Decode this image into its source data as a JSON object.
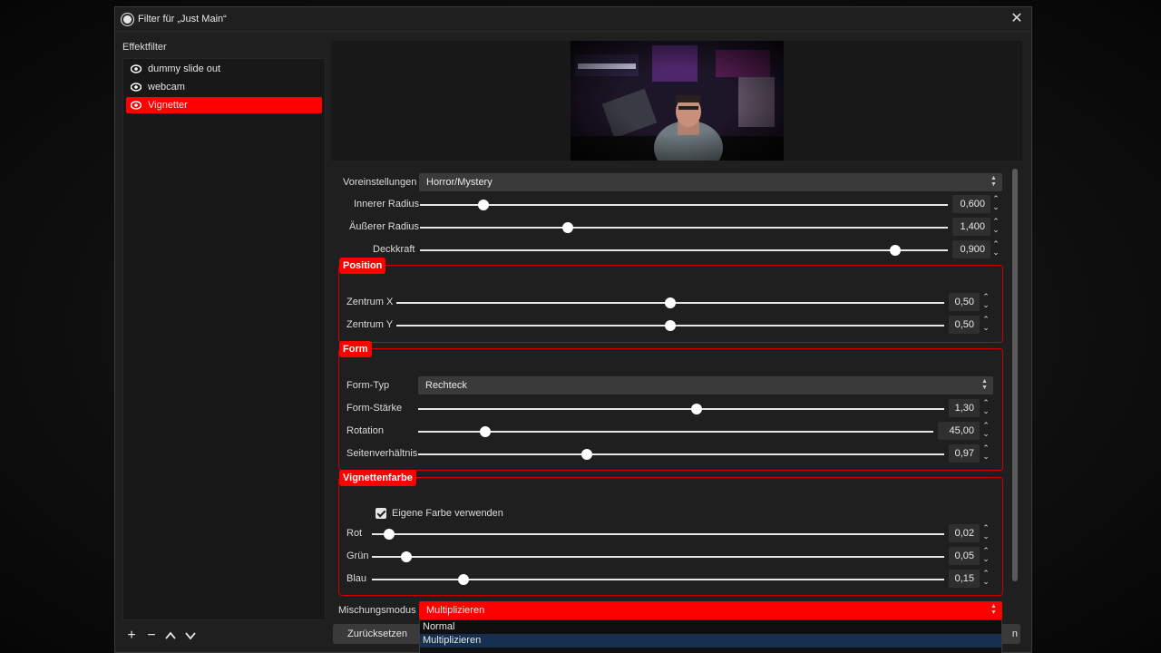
{
  "window": {
    "title": "Filter für „Just Main“"
  },
  "filters": {
    "heading": "Effektfilter",
    "items": [
      {
        "label": "dummy slide out",
        "selected": false
      },
      {
        "label": "webcam",
        "selected": false
      },
      {
        "label": "Vignetter",
        "selected": true
      }
    ]
  },
  "settings": {
    "preset": {
      "label": "Voreinstellungen",
      "value": "Horror/Mystery"
    },
    "inner_radius": {
      "label": "Innerer Radius",
      "value": "0,600",
      "level": 0.12
    },
    "outer_radius": {
      "label": "Äußerer Radius",
      "value": "1,400",
      "level": 0.28
    },
    "opacity": {
      "label": "Deckkraft",
      "value": "0,900",
      "level": 0.9
    },
    "position": {
      "title": "Position",
      "center_x": {
        "label": "Zentrum X",
        "value": "0,50",
        "level": 0.5
      },
      "center_y": {
        "label": "Zentrum Y",
        "value": "0,50",
        "level": 0.5
      }
    },
    "form": {
      "title": "Form",
      "type": {
        "label": "Form-Typ",
        "value": "Rechteck"
      },
      "strength": {
        "label": "Form-Stärke",
        "value": "1,30",
        "level": 0.53
      },
      "rotation": {
        "label": "Rotation",
        "value": "45,00",
        "level": 0.13
      },
      "aspect": {
        "label": "Seitenverhältnis",
        "value": "0,97",
        "level": 0.32
      }
    },
    "color": {
      "title": "Vignettenfarbe",
      "use_own_color": {
        "label": "Eigene Farbe verwenden",
        "checked": true
      },
      "red": {
        "label": "Rot",
        "value": "0,02",
        "level": 0.03
      },
      "green": {
        "label": "Grün",
        "value": "0,05",
        "level": 0.06
      },
      "blue": {
        "label": "Blau",
        "value": "0,15",
        "level": 0.16
      }
    },
    "blend_mode": {
      "label": "Mischungsmodus",
      "value": "Multiplizieren"
    }
  },
  "dropdown": {
    "options": [
      "Normal",
      "Multiplizieren"
    ],
    "highlighted": 1
  },
  "buttons": {
    "reset": "Zurücksetzen",
    "close": "n"
  },
  "colors": {
    "accent": "#ff0000",
    "window": "#1f1f1f",
    "panel": "#181818"
  }
}
